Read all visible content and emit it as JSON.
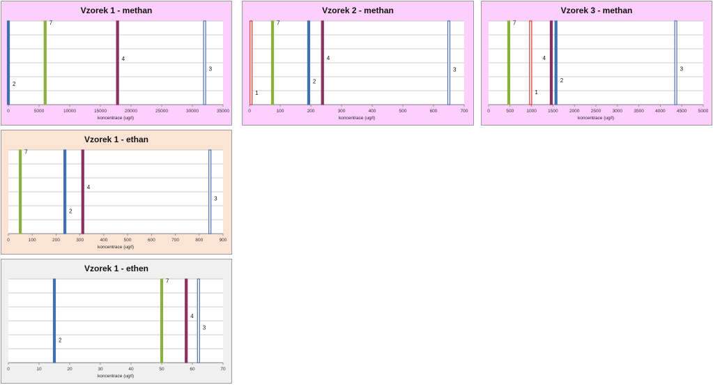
{
  "colors": {
    "pink_bg": "#fccffc",
    "peach_bg": "#fce4d4",
    "gray_bg": "#f0f0f0",
    "series": {
      "1": "#e03030",
      "2": "#4070b0",
      "3": "#4f6fb0",
      "4": "#8b3060",
      "7": "#8cb040"
    }
  },
  "chart_data": [
    {
      "type": "bar",
      "title": "Vzorek 1 - methan",
      "xlabel": "koncentrace (ug/l)",
      "xlim": [
        0,
        35000
      ],
      "xticks": [
        "0",
        "5000",
        "10000",
        "15000",
        "20000",
        "25000",
        "30000",
        "35000"
      ],
      "points": [
        {
          "label": "2",
          "x": 0,
          "y": 0.25
        },
        {
          "label": "7",
          "x": 6000,
          "y": 0.98
        },
        {
          "label": "4",
          "x": 17800,
          "y": 0.55
        },
        {
          "label": "3",
          "x": 32000,
          "y": 0.43
        }
      ]
    },
    {
      "type": "bar",
      "title": "Vzorek 2 - methan",
      "xlabel": "koncentrace (ug/l)",
      "xlim": [
        0,
        700
      ],
      "xticks": [
        "0",
        "100",
        "200",
        "300",
        "400",
        "500",
        "600",
        "700"
      ],
      "points": [
        {
          "label": "1",
          "x": 5,
          "y": 0.14
        },
        {
          "label": "7",
          "x": 75,
          "y": 0.98
        },
        {
          "label": "2",
          "x": 193,
          "y": 0.28
        },
        {
          "label": "4",
          "x": 238,
          "y": 0.56
        },
        {
          "label": "3",
          "x": 650,
          "y": 0.42
        }
      ]
    },
    {
      "type": "bar",
      "title": "Vzorek 3 - methan",
      "xlabel": "koncentrace (ug/l)",
      "xlim": [
        0,
        5000
      ],
      "xticks": [
        "0",
        "500",
        "1000",
        "1500",
        "2000",
        "2500",
        "3000",
        "3500",
        "4000",
        "4500",
        "5000"
      ],
      "points": [
        {
          "label": "7",
          "x": 470,
          "y": 0.98
        },
        {
          "label": "1",
          "x": 980,
          "y": 0.15
        },
        {
          "label": "4",
          "x": 1460,
          "y": 0.56,
          "left": true
        },
        {
          "label": "2",
          "x": 1570,
          "y": 0.29
        },
        {
          "label": "3",
          "x": 4360,
          "y": 0.43
        }
      ]
    },
    {
      "type": "bar",
      "title": "Vzorek 1 - ethan",
      "xlabel": "koncentrace (ug/l)",
      "xlim": [
        0,
        900
      ],
      "xticks": [
        "0",
        "100",
        "200",
        "300",
        "400",
        "500",
        "600",
        "700",
        "800",
        "900"
      ],
      "points": [
        {
          "label": "7",
          "x": 50,
          "y": 0.98
        },
        {
          "label": "2",
          "x": 237,
          "y": 0.27
        },
        {
          "label": "4",
          "x": 312,
          "y": 0.56
        },
        {
          "label": "3",
          "x": 845,
          "y": 0.42
        }
      ]
    },
    {
      "type": "bar",
      "title": "Vzorek 1 - ethen",
      "xlabel": "koncentrace (ug/l)",
      "xlim": [
        0,
        70
      ],
      "xticks": [
        "0",
        "10",
        "20",
        "30",
        "40",
        "50",
        "60",
        "70"
      ],
      "points": [
        {
          "label": "2",
          "x": 15,
          "y": 0.27
        },
        {
          "label": "7",
          "x": 50,
          "y": 0.98
        },
        {
          "label": "4",
          "x": 58,
          "y": 0.56
        },
        {
          "label": "3",
          "x": 62,
          "y": 0.42
        }
      ]
    }
  ]
}
